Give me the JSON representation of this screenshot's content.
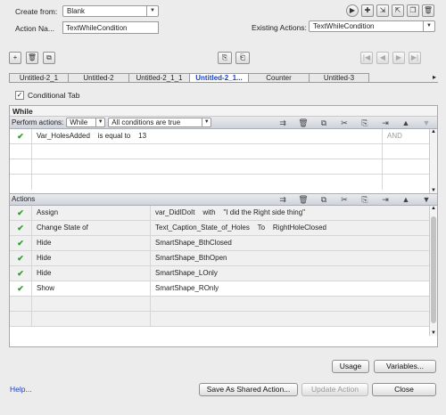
{
  "header": {
    "create_from_label": "Create from:",
    "create_from_value": "Blank",
    "action_name_label": "Action Na...",
    "action_name_value": "TextWhileCondition",
    "existing_label": "Existing Actions:",
    "existing_value": "TextWhileCondition"
  },
  "top_icons": [
    "play-icon",
    "add-icon",
    "import-icon",
    "export-icon",
    "duplicate-icon",
    "delete-icon"
  ],
  "tabs": [
    "Untitled-2_1",
    "Untitled-2",
    "Untitled-2_1_1",
    "Untitled-2_1...",
    "Counter",
    "Untitled-3"
  ],
  "active_tab": 3,
  "conditional": {
    "label": "Conditional Tab",
    "checked": true
  },
  "section_title": "While",
  "perform": {
    "label": "Perform actions:",
    "mode": "While",
    "conditions": "All conditions are true"
  },
  "conditions_rows": [
    {
      "check": "✔",
      "variable": "Var_HolesAdded",
      "text": "Var_HolesAdded    is equal to    13",
      "op": "AND"
    }
  ],
  "actions_header": "Actions",
  "actions_rows": [
    {
      "check": "✔",
      "action": "Assign",
      "target": "var_DidIDoIt    with    \"I did the Right side thing\""
    },
    {
      "check": "✔",
      "action": "Change State of",
      "target": "Text_Caption_State_of_Holes    To    RightHoleClosed"
    },
    {
      "check": "✔",
      "action": "Hide",
      "target": "SmartShape_BthClosed"
    },
    {
      "check": "✔",
      "action": "Hide",
      "target": "SmartShape_BthOpen"
    },
    {
      "check": "✔",
      "action": "Hide",
      "target": "SmartShape_LOnly"
    },
    {
      "check": "✔",
      "action": "Show",
      "target": "SmartShape_ROnly"
    }
  ],
  "buttons": {
    "usage": "Usage",
    "variables": "Variables...",
    "help": "Help...",
    "save_shared": "Save As Shared Action...",
    "update": "Update Action",
    "close": "Close"
  },
  "colors": {
    "accent": "#1a3fbf",
    "check": "#2e9b2e"
  }
}
